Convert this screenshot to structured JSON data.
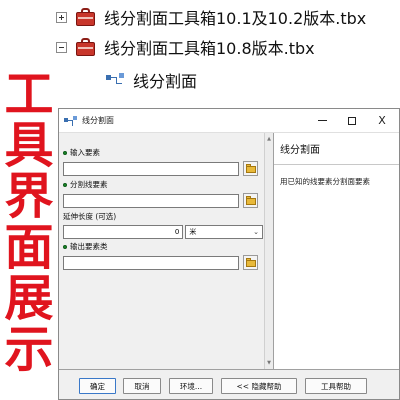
{
  "catalog": {
    "items": [
      {
        "label": "线分割面工具箱10.1及10.2版本.tbx",
        "toggle": "plus",
        "icon": "toolbox-icon"
      },
      {
        "label": "线分割面工具箱10.8版本.tbx",
        "toggle": "minus",
        "icon": "toolbox-icon"
      },
      {
        "label": "线分割面",
        "icon": "tool-icon"
      }
    ]
  },
  "caption": {
    "chars": [
      "工",
      "具",
      "界",
      "面",
      "展",
      "示"
    ],
    "color": "#e0141e"
  },
  "dialog": {
    "title": "线分割面",
    "window_controls": {
      "minimize": "—",
      "maximize": "□",
      "close": "X"
    },
    "params": {
      "input_features": {
        "label": "输入要素",
        "value": ""
      },
      "split_features": {
        "label": "分割线要素",
        "value": ""
      },
      "extend_length": {
        "label": "延伸长度 (可选)",
        "value": "0",
        "unit": "米"
      },
      "output_features": {
        "label": "输出要素类",
        "value": ""
      }
    },
    "help": {
      "title": "线分割面",
      "body": "用已知的线要素分割面要素"
    },
    "buttons": {
      "ok": "确定",
      "cancel": "取消",
      "environments": "环境...",
      "hide_help": "<< 隐藏帮助",
      "tool_help": "工具帮助"
    }
  },
  "colors": {
    "required_dot": "#1a8a2a",
    "toolbox_red": "#c8362b",
    "caption_red": "#e0141e"
  }
}
